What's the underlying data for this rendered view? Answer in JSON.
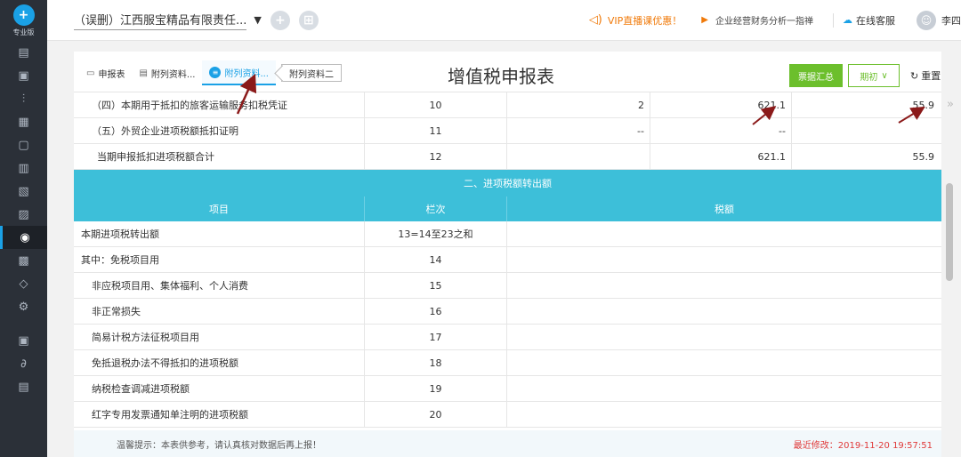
{
  "sidebar": {
    "logo_text": "专业版"
  },
  "topbar": {
    "company": "（误删）江西服宝精品有限责任...",
    "vip": "VIP直播课优惠！",
    "guide": "企业经营财务分析一指禅",
    "service": "在线客服",
    "user": "李四"
  },
  "tabs": [
    {
      "label": "申报表"
    },
    {
      "label": "附列资料..."
    },
    {
      "label": "附列资料..."
    },
    {
      "label": "附列资料二"
    }
  ],
  "title": "增值税申报表",
  "buttons": {
    "summary": "票据汇总",
    "period": "期初",
    "reset": "重置"
  },
  "top_rows": [
    {
      "item": "（四）本期用于抵扣的旅客运输服务扣税凭证",
      "line": "10",
      "c3": "2",
      "c4": "621.1",
      "c5": "55.9"
    },
    {
      "item": "（五）外贸企业进项税额抵扣证明",
      "line": "11",
      "c3": "--",
      "c4": "--",
      "c5": ""
    },
    {
      "item": "当期申报抵扣进项税额合计",
      "line": "12",
      "c3": "",
      "c4": "621.1",
      "c5": "55.9"
    }
  ],
  "section_title": "二、进项税额转出额",
  "headers": {
    "item": "项目",
    "line": "栏次",
    "amount": "税额"
  },
  "rows": [
    {
      "item": "本期进项税转出额",
      "line": "13=14至23之和"
    },
    {
      "item": "其中：免税项目用",
      "line": "14"
    },
    {
      "item": "非应税项目用、集体福利、个人消费",
      "line": "15"
    },
    {
      "item": "非正常损失",
      "line": "16"
    },
    {
      "item": "简易计税方法征税项目用",
      "line": "17"
    },
    {
      "item": "免抵退税办法不得抵扣的进项税额",
      "line": "18"
    },
    {
      "item": "纳税检查调减进项税额",
      "line": "19"
    },
    {
      "item": "红字专用发票通知单注明的进项税额",
      "line": "20"
    }
  ],
  "footer": {
    "tip": "温馨提示：本表供参考，请认真核对数据后再上报！",
    "modified": "最近修改：2019-11-20 19:57:51"
  },
  "colors": {
    "accent": "#3dbfd9",
    "green": "#6cbf2c",
    "rail": "#2b3038",
    "annotation": "#8b1a1a"
  }
}
